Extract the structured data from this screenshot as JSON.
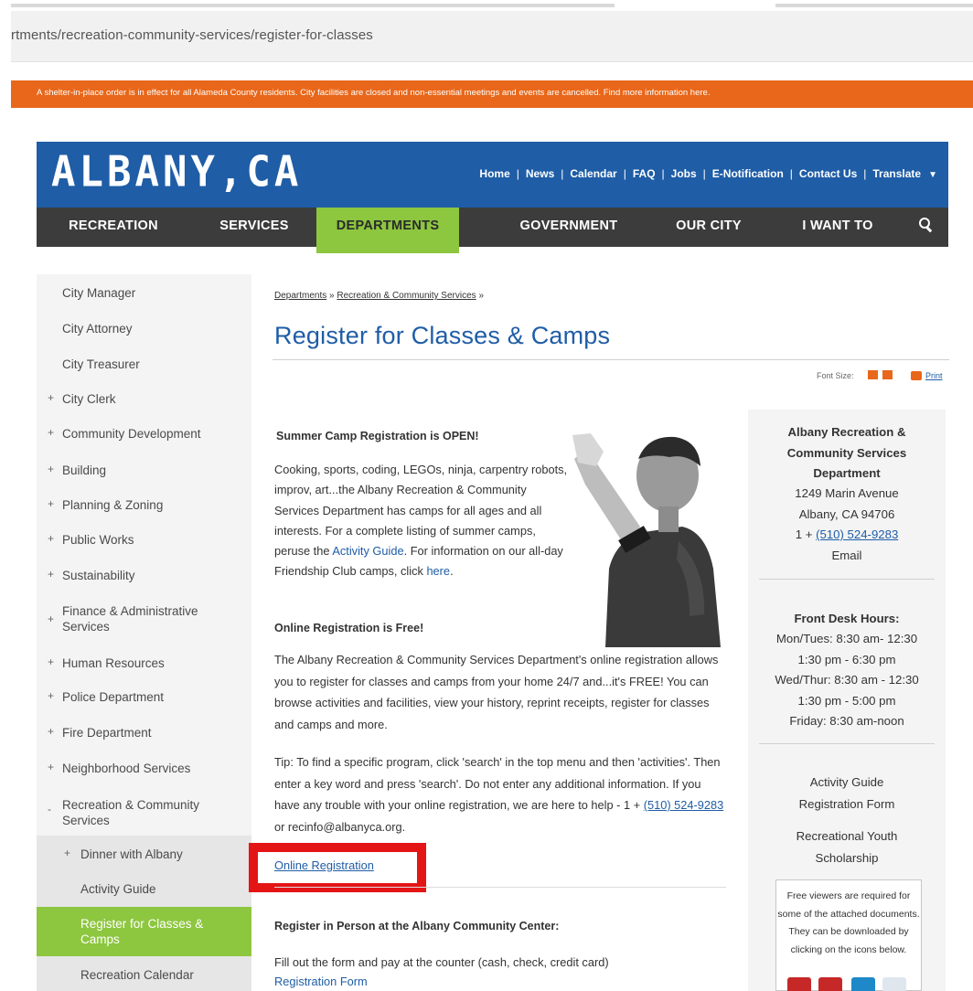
{
  "browser": {
    "url": "rtments/recreation-community-services/register-for-classes"
  },
  "alert": {
    "text": "A shelter-in-place order is in effect for all Alameda County residents. City facilities are closed and non-essential meetings and events are cancelled.  Find more information here."
  },
  "header": {
    "logo": "ALBANY,CA",
    "links": [
      "Home",
      "News",
      "Calendar",
      "FAQ",
      "Jobs",
      "E-Notification",
      "Contact Us",
      "Translate"
    ]
  },
  "nav": {
    "items": [
      "RECREATION",
      "SERVICES",
      "DEPARTMENTS",
      "GOVERNMENT",
      "OUR CITY",
      "I WANT TO"
    ],
    "active": "DEPARTMENTS"
  },
  "sidebar": {
    "items": [
      {
        "label": "City Manager",
        "plus": ""
      },
      {
        "label": "City Attorney",
        "plus": ""
      },
      {
        "label": "City Treasurer",
        "plus": ""
      },
      {
        "label": "City Clerk",
        "plus": "+"
      },
      {
        "label": "Community Development",
        "plus": "+"
      },
      {
        "label": "Building",
        "plus": "+"
      },
      {
        "label": "Planning & Zoning",
        "plus": "+"
      },
      {
        "label": "Public Works",
        "plus": "+"
      },
      {
        "label": "Sustainability",
        "plus": "+"
      },
      {
        "label": "Finance & Administrative Services",
        "plus": "+"
      },
      {
        "label": "Human Resources",
        "plus": "+"
      },
      {
        "label": "Police Department",
        "plus": "+"
      },
      {
        "label": "Fire Department",
        "plus": "+"
      },
      {
        "label": "Neighborhood Services",
        "plus": "+"
      },
      {
        "label": "Recreation & Community Services",
        "plus": "-"
      }
    ],
    "subitems": [
      {
        "label": "Dinner with Albany",
        "plus": "+"
      },
      {
        "label": "Activity Guide",
        "plus": ""
      },
      {
        "label": "Register for Classes & Camps",
        "plus": ""
      },
      {
        "label": "Recreation Calendar",
        "plus": ""
      }
    ]
  },
  "breadcrumb": {
    "items": [
      "Departments",
      "Recreation & Community Services"
    ],
    "sep": "»"
  },
  "page": {
    "title": "Register for Classes & Camps",
    "font_size_label": "Font Size:",
    "print_label": "Print"
  },
  "content": {
    "camp_heading": "Summer Camp Registration is OPEN!",
    "camp_body": "Cooking, sports, coding, LEGOs, ninja, carpentry robots, improv, art...the Albany Recreation & Community Services Department has camps for all ages and all interests. For a complete listing of summer camps, peruse the",
    "activity_guide_link": "Activity Guide",
    "camp_body2": ". For information on our all-day Friendship Club camps, click",
    "here_link": "here",
    "camp_body3": ".",
    "online_heading": "Online Registration is Free!",
    "online_body": "The Albany Recreation & Community Services Department's online registration allows you to register for classes and camps from your home 24/7 and...it's FREE! You can browse activities and facilities, view your history, reprint receipts, register for classes and camps and more.",
    "tip_label": "Tip",
    "tip_body": ": To find a specific program, click 'search' in the top menu and then 'activities'. Then enter a key word and press 'search'. Do not enter any additional information. If you have any trouble with your online registration, we are here to help - 1 +",
    "tip_phone": "(510) 524-9283",
    "tip_email": "or recinfo@albanyca.org.",
    "online_reg_link": "Online Registration",
    "inperson_heading": "Register in Person at the Albany Community Center:",
    "inperson_body": "Fill out the form and pay at the counter (cash, check, credit card)",
    "reg_form_link": "Registration Form"
  },
  "right_col": {
    "dept_name": "Albany Recreation & Community Services Department",
    "address1": "1249 Marin Avenue",
    "address2": "Albany, CA 94706",
    "phone_prefix": "1 +",
    "phone": "(510) 524-9283",
    "email_link": "Email",
    "hours_title": "Front Desk Hours:",
    "hours": [
      "Mon/Tues: 8:30 am- 12:30",
      "1:30 pm - 6:30 pm",
      "Wed/Thur: 8:30 am - 12:30",
      "1:30 pm - 5:00 pm",
      "Friday: 8:30 am-noon"
    ],
    "link1": "Activity Guide Registration Form",
    "link2": "Recreational Youth Scholarship",
    "viewer_note": "Free viewers are required for some of the attached documents. They can be downloaded by clicking on the icons below."
  },
  "colors": {
    "brand_blue": "#1f5da6",
    "nav_green": "#8dc63f",
    "alert_orange": "#e8671a",
    "highlight_red": "#e41515"
  }
}
